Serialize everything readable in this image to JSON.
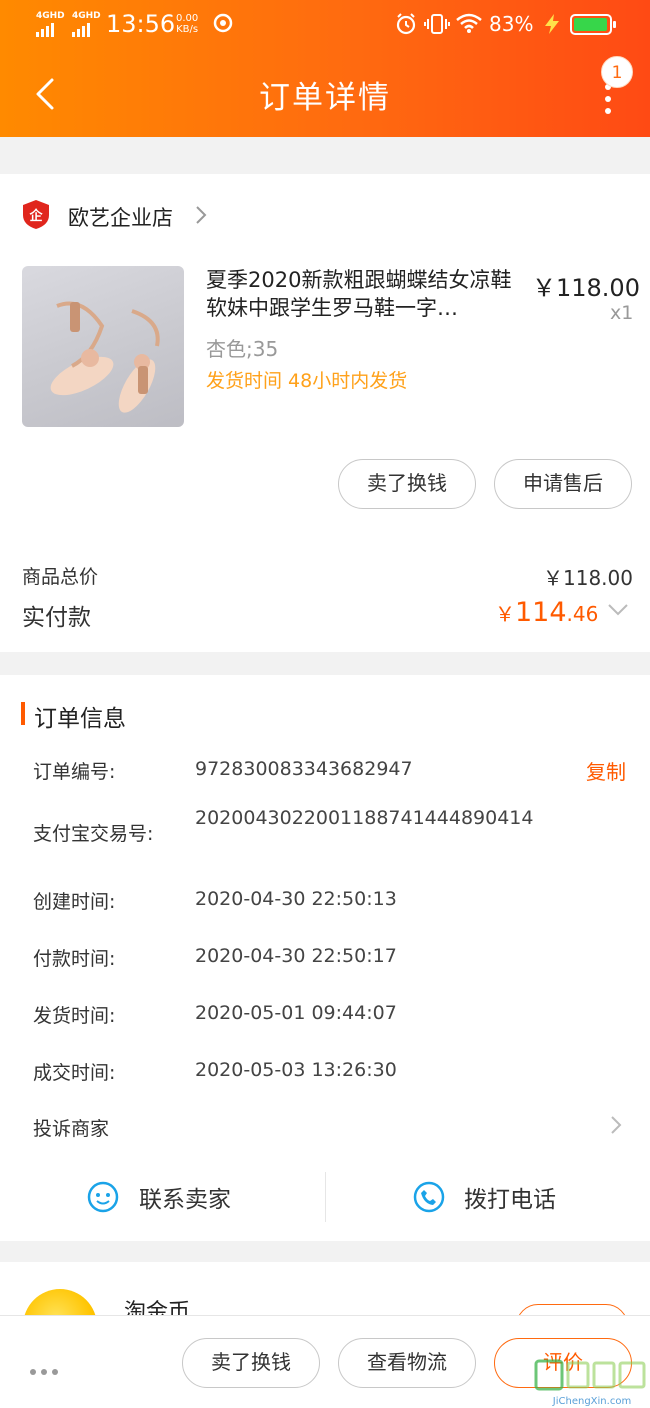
{
  "status_bar": {
    "sim1": "4GHD",
    "sim2": "4GHD",
    "time": "13:56",
    "net_speed_value": "0.00",
    "net_speed_unit": "KB/s",
    "battery_percent": "83%"
  },
  "header": {
    "title": "订单详情",
    "notification_count": "1"
  },
  "store": {
    "name": "欧艺企业店"
  },
  "product": {
    "title": "夏季2020新款粗跟蝴蝶结女凉鞋软妹中跟学生罗马鞋一字…",
    "price": "￥118.00",
    "quantity": "x1",
    "spec": "杏色;35",
    "shipping": "发货时间 48小时内发货"
  },
  "product_actions": {
    "sell_label": "卖了换钱",
    "aftersale_label": "申请售后"
  },
  "totals": {
    "goods_total_label": "商品总价",
    "goods_total_value": "￥118.00",
    "paid_label": "实付款",
    "paid_currency": "￥",
    "paid_integer": "114",
    "paid_decimal": ".46"
  },
  "order_info": {
    "section_title": "订单信息",
    "order_no_label": "订单编号:",
    "order_no_value": "972830083343682947",
    "copy_label": "复制",
    "alipay_label": "支付宝交易号:",
    "alipay_value": "2020043022001188741444890414",
    "created_label": "创建时间:",
    "created_value": "2020-04-30 22:50:13",
    "paid_time_label": "付款时间:",
    "paid_time_value": "2020-04-30 22:50:17",
    "shipped_label": "发货时间:",
    "shipped_value": "2020-05-01 09:44:07",
    "completed_label": "成交时间:",
    "completed_value": "2020-05-03 13:26:30",
    "complain_label": "投诉商家"
  },
  "contact": {
    "seller_label": "联系卖家",
    "phone_label": "拨打电话"
  },
  "coin": {
    "label": "淘金币"
  },
  "bottom_bar": {
    "sell_label": "卖了换钱",
    "logistics_label": "查看物流",
    "review_label": "评价"
  },
  "watermark": {
    "text": "JiChengXin.com"
  },
  "colors": {
    "accent": "#ff5a00",
    "header_start": "#ff8a00",
    "header_end": "#ff4a14",
    "shipping": "#ffa11a"
  }
}
